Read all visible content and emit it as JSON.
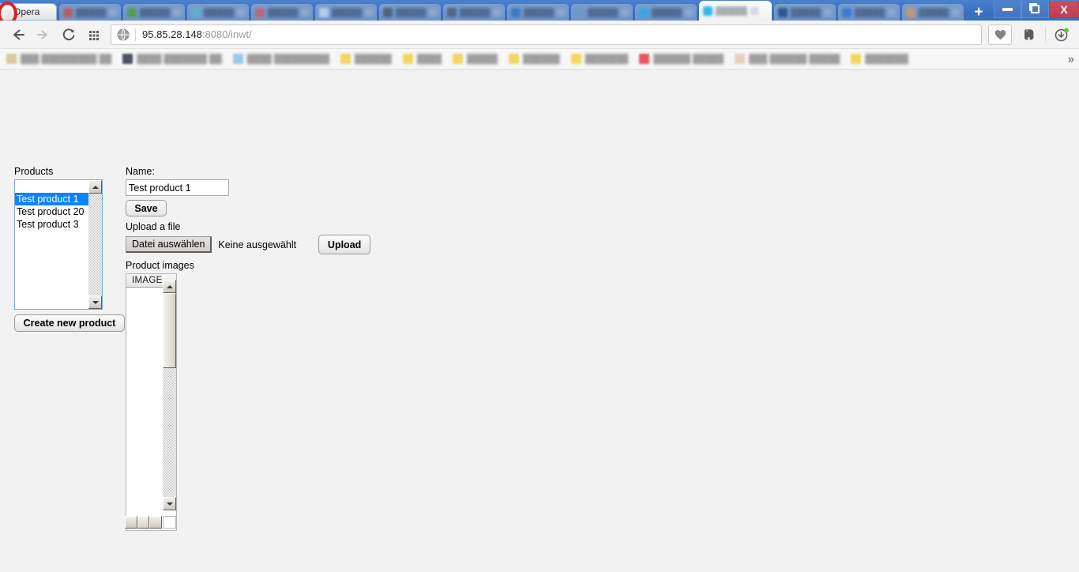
{
  "browser": {
    "menu_button_label": "Opera",
    "tabs": [
      {
        "title": "██████",
        "active": false,
        "favicon_color": "#d95b4c"
      },
      {
        "title": "███████",
        "active": false,
        "favicon_color": "#5aa83c"
      },
      {
        "title": "████████",
        "active": false,
        "favicon_color": "#6fc0cf"
      },
      {
        "title": "██████",
        "active": false,
        "favicon_color": "#d96b6b"
      },
      {
        "title": "█████",
        "active": false,
        "favicon_color": "#d6e4f5"
      },
      {
        "title": "███████",
        "active": false,
        "favicon_color": "#565f6b"
      },
      {
        "title": "██████",
        "active": false,
        "favicon_color": "#5b6472"
      },
      {
        "title": "███████",
        "active": false,
        "favicon_color": "#3f7fbf"
      },
      {
        "title": "████████",
        "active": false,
        "favicon_color": "#7da3c8"
      },
      {
        "title": "██████",
        "active": false,
        "favicon_color": "#35b6e8"
      },
      {
        "title": "█████",
        "active": true,
        "favicon_color": "#35b6e8"
      },
      {
        "title": "██████",
        "active": false,
        "favicon_color": "#2d4f7c"
      },
      {
        "title": "█████",
        "active": false,
        "favicon_color": "#3f7fd1"
      },
      {
        "title": "███████",
        "active": false,
        "favicon_color": "#e0a858"
      }
    ],
    "new_tab_label": "+",
    "window_controls": {
      "minimize_label": "—",
      "maximize_label": "❐",
      "close_label": "X"
    },
    "nav": {
      "back_label": "←",
      "forward_label": "→",
      "reload_label": "↻",
      "apps_label": "apps-grid"
    },
    "address": {
      "host": "95.85.28.148",
      "rest": ":8080/inwt/",
      "full_url": "95.85.28.148:8080/inwt/",
      "security_icon": "globe-icon"
    },
    "toolbar_icons": {
      "bookmark": "heart-icon",
      "evernote": "elephant-icon",
      "downloads": "download-circle-icon",
      "download_badge_color": "#5cc63f"
    },
    "bookmarks": [
      {
        "label": "███ █████████ ██",
        "icon_color": "#d9c89a",
        "icon_type": "page-icon"
      },
      {
        "label": "████ ███████ ██",
        "icon_color": "#4a5360",
        "icon_type": "page-icon"
      },
      {
        "label": "████ █████████",
        "icon_color": "#9cc8e8",
        "icon_type": "page-icon"
      },
      {
        "label": "██████",
        "icon_color": "#f2d860",
        "icon_type": "folder-icon"
      },
      {
        "label": "████",
        "icon_color": "#f2d860",
        "icon_type": "folder-icon"
      },
      {
        "label": "█████",
        "icon_color": "#f2d860",
        "icon_type": "folder-icon"
      },
      {
        "label": "██████",
        "icon_color": "#f2d860",
        "icon_type": "folder-icon"
      },
      {
        "label": "███████",
        "icon_color": "#f2d860",
        "icon_type": "folder-icon"
      },
      {
        "label": "██████ █████",
        "icon_color": "#e8565e",
        "icon_type": "page-icon"
      },
      {
        "label": "███ ██████ █████",
        "icon_color": "#e8cfc0",
        "icon_type": "page-icon"
      },
      {
        "label": "███████",
        "icon_color": "#f2d860",
        "icon_type": "folder-icon"
      }
    ],
    "bookmarks_overflow_label": "»"
  },
  "page": {
    "products": {
      "label": "Products",
      "items": [
        {
          "name": "",
          "selected": false
        },
        {
          "name": "Test product 1",
          "selected": true
        },
        {
          "name": "Test product 20",
          "selected": false
        },
        {
          "name": "Test product 3",
          "selected": false
        }
      ],
      "create_button_label": "Create new product",
      "selection_color": "#0a84ff"
    },
    "form": {
      "name_label": "Name:",
      "name_value": "Test product 1",
      "name_placeholder": "",
      "save_label": "Save",
      "upload_section_label": "Upload a file",
      "file_choose_label": "Datei auswählen",
      "file_status": "Keine ausgewählt",
      "upload_label": "Upload"
    },
    "images": {
      "section_label": "Product images",
      "columns": [
        "IMAGE"
      ],
      "rows": []
    }
  }
}
